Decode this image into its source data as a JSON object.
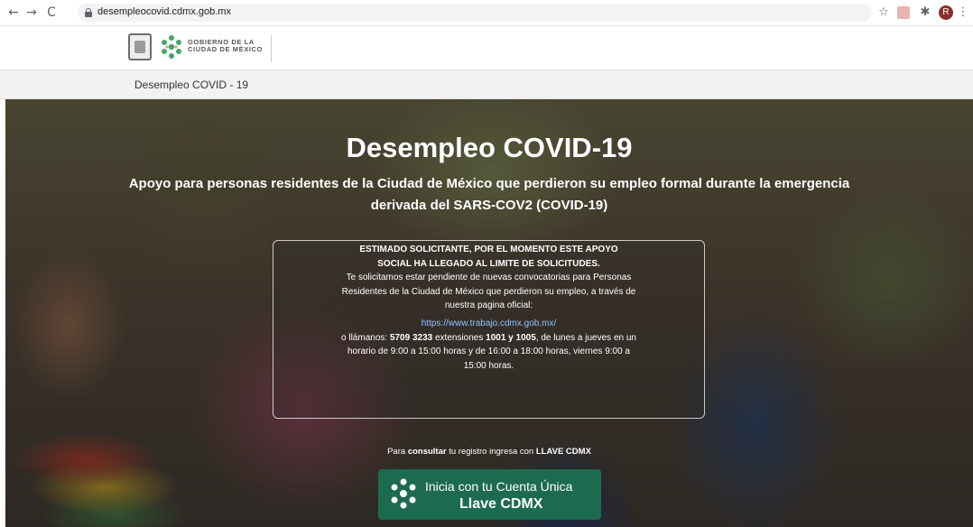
{
  "browser": {
    "back": "←",
    "forward": "→",
    "reload": "C",
    "url": "desempleocovid.cdmx.gob.mx",
    "avatar_initial": "R"
  },
  "header": {
    "gov_line1": "GOBIERNO DE LA",
    "gov_line2": "CIUDAD DE MÉXICO"
  },
  "subnav": {
    "label": "Desempleo COVID - 19"
  },
  "hero": {
    "title": "Desempleo COVID-19",
    "subtitle": "Apoyo para personas residentes de la Ciudad de México que perdieron su empleo formal durante la emergencia derivada del SARS-COV2 (COVID-19)"
  },
  "notice": {
    "warning": "ESTIMADO SOLICITANTE, POR EL MOMENTO ESTE APOYO SOCIAL HA LLEGADO AL LIMITE DE SOLICITUDES.",
    "body": "Te solicitamos estar pendiente de nuevas convocatorias para Personas Residentes de la Ciudad de México que perdieron su empleo, a través de nuestra pagina oficial:",
    "link": "https://www.trabajo.cdmx.gob.mx/",
    "call_prefix": "o llámanos: ",
    "phone": "5709 3233",
    "ext_prefix": " extensiones ",
    "extensions": "1001 y 1005",
    "call_suffix": ", de lunes a jueves en un horario de 9:00 a 15:00 horas y de 16:00 a 18:00 horas, viernes 9:00 a 15:00 horas."
  },
  "consult": {
    "prefix": "Para ",
    "verb": "consultar",
    "middle": " tu registro ingresa con ",
    "llave": "LLAVE CDMX"
  },
  "llave_button": {
    "line1": "Inicia con tu Cuenta Única",
    "line2": "Llave CDMX"
  },
  "colors": {
    "llave_green": "#1d6b4e",
    "link_blue": "#8fc3ff",
    "logo_green": "#4aa36b"
  }
}
